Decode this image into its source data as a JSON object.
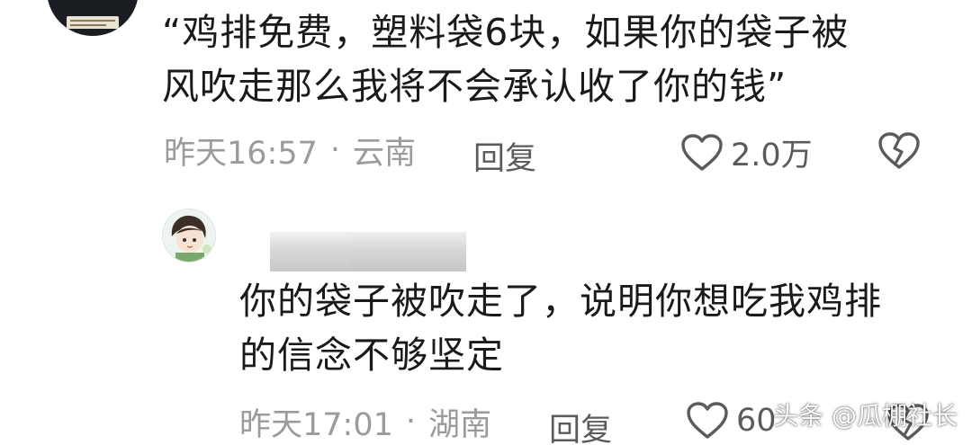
{
  "comment": {
    "text_line1": "“鸡排免费，塑料袋6块，如果你的袋子被",
    "text_line2": "风吹走那么我将不会承认收了你的钱”",
    "time": "昨天16:57",
    "separator": "·",
    "location": "云南",
    "reply_label": "回复",
    "like_count": "2.0万"
  },
  "reply": {
    "text_line1": "你的袋子被吹走了，说明你想吃我鸡排",
    "text_line2": "的信念不够坚定",
    "time": "昨天17:01",
    "separator": "·",
    "location": "湖南",
    "reply_label": "回复",
    "like_count": "60"
  },
  "watermark": "头条 @瓜棚社长",
  "icons": {
    "like": "heart-outline-icon",
    "dislike": "broken-heart-icon"
  },
  "colors": {
    "text": "#1a1a1a",
    "meta": "#9b9b9b",
    "action": "#5b5b5b"
  }
}
